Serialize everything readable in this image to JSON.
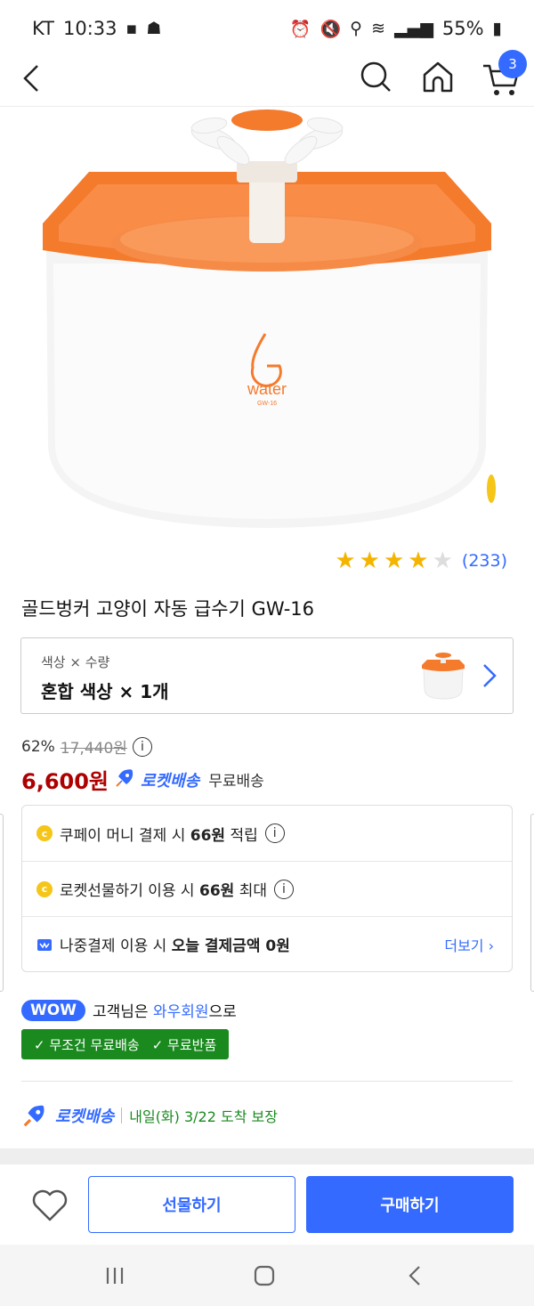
{
  "status_bar": {
    "carrier": "KT",
    "time": "10:33",
    "battery": "55%"
  },
  "nav": {
    "cart_count": "3"
  },
  "product": {
    "image_logo_text": "water",
    "image_model_text": "GW-16",
    "rating": 4,
    "rating_max": 5,
    "review_count": "(233)",
    "title": "골드벙커 고양이 자동 급수기 GW-16"
  },
  "option": {
    "label": "색상 × 수량",
    "value": "혼합 색상 × 1개"
  },
  "price": {
    "discount_rate": "62%",
    "original_price": "17,440원",
    "sale_price": "6,600원",
    "rocket_label": "로켓배송",
    "shipping": "무료배송"
  },
  "benefits": [
    {
      "prefix": "쿠페이 머니 결제 시 ",
      "amount": "66원",
      "suffix": " 적립"
    },
    {
      "prefix": "로켓선물하기 이용 시 ",
      "amount": "66원",
      "suffix": " 최대"
    },
    {
      "prefix": "나중결제 이용 시 ",
      "amount": "오늘 결제금액 0원",
      "suffix": "",
      "more": "더보기 ›"
    }
  ],
  "wow": {
    "badge": "WOW",
    "text_before": "고객님은 ",
    "member": "와우회원",
    "text_after": "으로",
    "perk1": "✓ 무조건 무료배송",
    "perk2": "✓ 무료반품"
  },
  "delivery": {
    "rocket_label": "로켓배송",
    "date_text": "내일(화) 3/22 도착 보장"
  },
  "bottom": {
    "gift_label": "선물하기",
    "buy_label": "구매하기"
  },
  "colors": {
    "brand_blue": "#346aff",
    "sale_red": "#ae0000",
    "wow_green": "#1a8a1f",
    "product_orange": "#f47a2c",
    "star_yellow": "#f5b400"
  },
  "icons": [
    "back-arrow-icon",
    "search-icon",
    "home-icon",
    "cart-icon",
    "info-icon",
    "coin-icon",
    "chevron-right-icon",
    "heart-icon",
    "rocket-icon"
  ]
}
